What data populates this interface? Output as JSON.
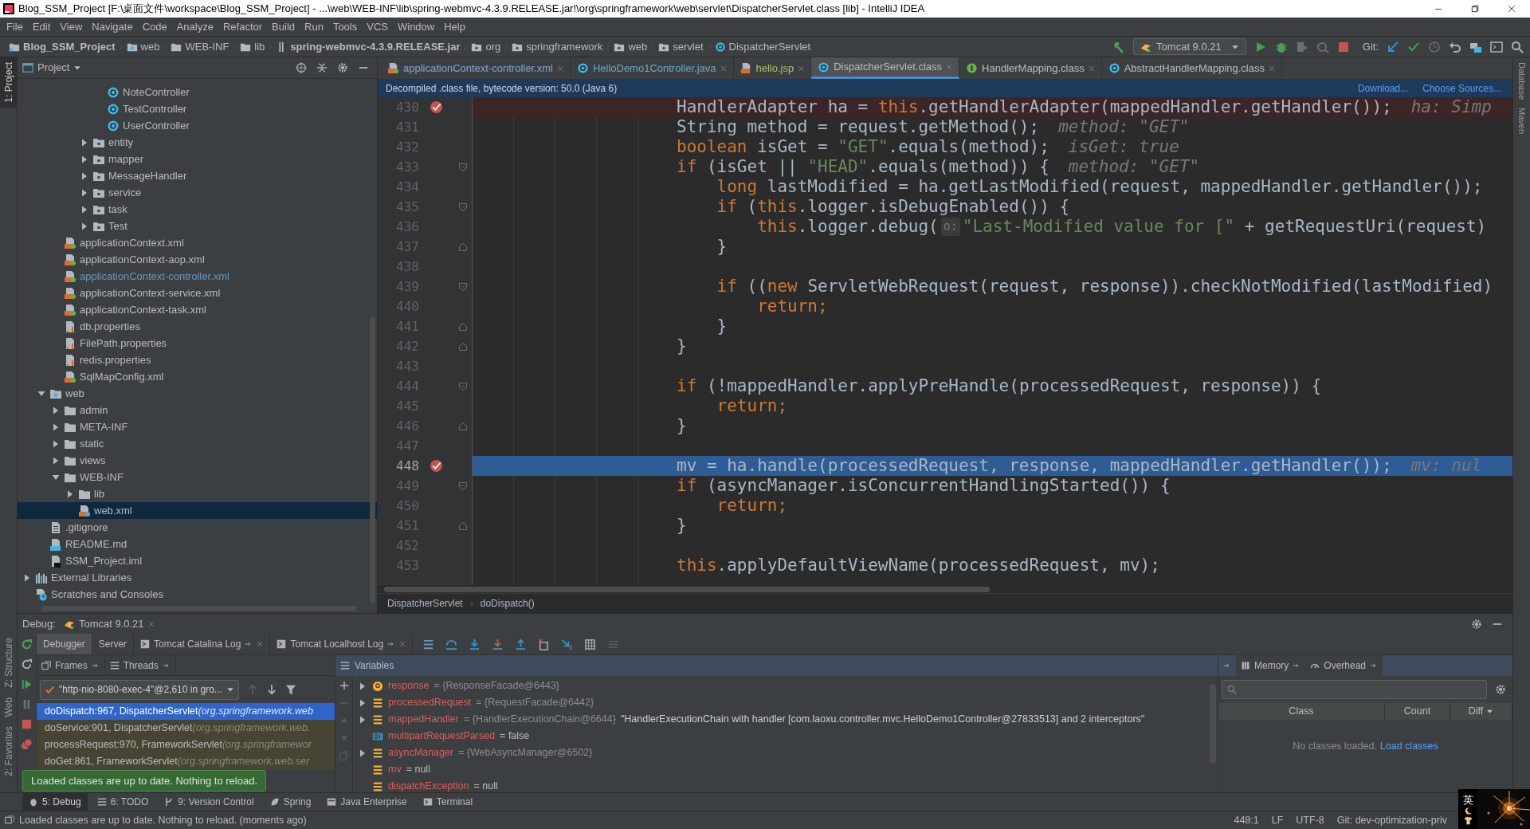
{
  "window": {
    "title": "Blog_SSM_Project [F:\\桌面文件\\workspace\\Blog_SSM_Project] - ...\\web\\WEB-INF\\lib\\spring-webmvc-4.3.9.RELEASE.jar!\\org\\springframework\\web\\servlet\\DispatcherServlet.class [lib] - IntelliJ IDEA"
  },
  "menu": [
    "File",
    "Edit",
    "View",
    "Navigate",
    "Code",
    "Analyze",
    "Refactor",
    "Build",
    "Run",
    "Tools",
    "VCS",
    "Window",
    "Help"
  ],
  "breadcrumbs": [
    {
      "label": "Blog_SSM_Project",
      "kind": "project"
    },
    {
      "label": "web",
      "kind": "webfolder"
    },
    {
      "label": "WEB-INF",
      "kind": "folder"
    },
    {
      "label": "lib",
      "kind": "folder"
    },
    {
      "label": "spring-webmvc-4.3.9.RELEASE.jar",
      "kind": "jar"
    },
    {
      "label": "org",
      "kind": "package"
    },
    {
      "label": "springframework",
      "kind": "package"
    },
    {
      "label": "web",
      "kind": "package"
    },
    {
      "label": "servlet",
      "kind": "package"
    },
    {
      "label": "DispatcherServlet",
      "kind": "class"
    }
  ],
  "run_config": "Tomcat 9.0.21",
  "vcs_label": "Git:",
  "left_tool_windows": [
    {
      "label": "1: Project",
      "selected": true
    },
    {
      "label": "Z: Structure",
      "selected": false
    },
    {
      "label": "Web",
      "selected": false
    },
    {
      "label": "2: Favorites",
      "selected": false
    }
  ],
  "right_tool_windows": [
    "Database",
    "Maven"
  ],
  "project": {
    "title": "Project",
    "tree": [
      {
        "children": [
          {
            "children": [
              {
                "children": [
                  {
                    "children": [
                      {
                        "children": [
                          {
                            "label": "NoteController",
                            "kind": "class"
                          },
                          {
                            "label": "TestController",
                            "kind": "class"
                          },
                          {
                            "label": "UserController",
                            "kind": "class"
                          }
                        ]
                      },
                      {
                        "label": "entity",
                        "kind": "package",
                        "expanded": false
                      },
                      {
                        "label": "mapper",
                        "kind": "package",
                        "expanded": false
                      },
                      {
                        "label": "MessageHandler",
                        "kind": "package",
                        "expanded": false
                      },
                      {
                        "label": "service",
                        "kind": "package",
                        "expanded": false
                      },
                      {
                        "label": "task",
                        "kind": "package",
                        "expanded": false
                      },
                      {
                        "label": "Test",
                        "kind": "package",
                        "expanded": false
                      }
                    ]
                  }
                ]
              },
              {
                "label": "applicationContext.xml",
                "kind": "xml",
                "modified": false
              },
              {
                "label": "applicationContext-aop.xml",
                "kind": "xml",
                "modified": false
              },
              {
                "label": "applicationContext-controller.xml",
                "kind": "xml",
                "modified": true
              },
              {
                "label": "applicationContext-service.xml",
                "kind": "xml",
                "modified": false
              },
              {
                "label": "applicationContext-task.xml",
                "kind": "xml",
                "modified": false
              },
              {
                "label": "db.properties",
                "kind": "properties"
              },
              {
                "label": "FilePath.properties",
                "kind": "properties"
              },
              {
                "label": "redis.properties",
                "kind": "properties"
              },
              {
                "label": "SqlMapConfig.xml",
                "kind": "xml",
                "modified": false
              }
            ]
          },
          {
            "label": "web",
            "kind": "webfolder",
            "expanded": true,
            "children": [
              {
                "label": "admin",
                "kind": "folder",
                "expanded": false
              },
              {
                "label": "META-INF",
                "kind": "folder",
                "expanded": false
              },
              {
                "label": "static",
                "kind": "folder",
                "expanded": false
              },
              {
                "label": "views",
                "kind": "folder",
                "expanded": false
              },
              {
                "label": "WEB-INF",
                "kind": "folder",
                "expanded": true,
                "children": [
                  {
                    "label": "lib",
                    "kind": "folder",
                    "expanded": false
                  },
                  {
                    "label": "web.xml",
                    "kind": "webxml",
                    "selected": true
                  }
                ]
              }
            ]
          },
          {
            "label": ".gitignore",
            "kind": "text"
          },
          {
            "label": "README.md",
            "kind": "markdown"
          },
          {
            "label": "SSM_Project.iml",
            "kind": "iml"
          }
        ]
      },
      {
        "label": "External Libraries",
        "kind": "libraries",
        "expanded": false
      },
      {
        "label": "Scratches and Consoles",
        "kind": "scratches"
      }
    ]
  },
  "editor_tabs": [
    {
      "label": "applicationContext-controller.xml",
      "kind": "xml",
      "selected": false,
      "color": "#7ea6d6"
    },
    {
      "label": "HelloDemo1Controller.java",
      "kind": "class",
      "selected": false,
      "color": "#6aa8c8"
    },
    {
      "label": "hello.jsp",
      "kind": "jsp",
      "selected": false,
      "color": "#a8c66c"
    },
    {
      "label": "DispatcherServlet.class",
      "kind": "class",
      "selected": true,
      "color": "#bbbbbb"
    },
    {
      "label": "HandlerMapping.class",
      "kind": "interface",
      "selected": false,
      "color": "#bbbbbb"
    },
    {
      "label": "AbstractHandlerMapping.class",
      "kind": "class",
      "selected": false,
      "color": "#bbbbbb"
    }
  ],
  "notice": {
    "text": "Decompiled .class file, bytecode version: 50.0 (Java 6)",
    "links": [
      "Download...",
      "Choose Sources..."
    ]
  },
  "code": [
    {
      "number": "430",
      "breakpoint": true,
      "current": false,
      "tokens": [
        {
          "kind": "plain",
          "text": "HandlerAdapter ha = "
        },
        {
          "kind": "keyword",
          "text": "this"
        },
        {
          "kind": "plain",
          "text": ".getHandlerAdapter(mappedHandler.getHandler());"
        },
        {
          "kind": "hint",
          "text": "ha: Simp"
        }
      ]
    },
    {
      "number": "431",
      "breakpoint": false,
      "current": false,
      "tokens": [
        {
          "kind": "plain",
          "text": "String method = request.getMethod();"
        },
        {
          "kind": "hint",
          "text": "method: \"GET\""
        }
      ]
    },
    {
      "number": "432",
      "breakpoint": false,
      "current": false,
      "tokens": [
        {
          "kind": "keyword",
          "text": "boolean"
        },
        {
          "kind": "plain",
          "text": " isGet = "
        },
        {
          "kind": "string",
          "text": "\"GET\""
        },
        {
          "kind": "plain",
          "text": ".equals(method);"
        },
        {
          "kind": "hint",
          "text": "isGet: true"
        }
      ]
    },
    {
      "number": "433",
      "breakpoint": false,
      "current": false,
      "fold_start": true,
      "tokens": [
        {
          "kind": "keyword",
          "text": "if"
        },
        {
          "kind": "plain",
          "text": " (isGet || "
        },
        {
          "kind": "string",
          "text": "\"HEAD\""
        },
        {
          "kind": "plain",
          "text": ".equals(method)) {"
        },
        {
          "kind": "hint",
          "text": "method: \"GET\""
        }
      ]
    },
    {
      "number": "434",
      "breakpoint": false,
      "current": false,
      "tokens": [
        {
          "kind": "keyword",
          "text": "    long"
        },
        {
          "kind": "plain",
          "text": " lastModified = ha.getLastModified(request, mappedHandler.getHandler());"
        }
      ]
    },
    {
      "number": "435",
      "breakpoint": false,
      "current": false,
      "fold_start": true,
      "tokens": [
        {
          "kind": "keyword",
          "text": "    if"
        },
        {
          "kind": "plain",
          "text": " ("
        },
        {
          "kind": "keyword",
          "text": "this"
        },
        {
          "kind": "plain",
          "text": ".logger.isDebugEnabled()) {"
        }
      ]
    },
    {
      "number": "436",
      "breakpoint": false,
      "current": false,
      "tokens": [
        {
          "kind": "keyword",
          "text": "        this"
        },
        {
          "kind": "plain",
          "text": ".logger.debug("
        },
        {
          "kind": "param_hint",
          "text": "o:"
        },
        {
          "kind": "string",
          "text": "\"Last-Modified value for [\""
        },
        {
          "kind": "plain",
          "text": " + getRequestUri(request)"
        }
      ]
    },
    {
      "number": "437",
      "breakpoint": false,
      "current": false,
      "fold_end": true,
      "tokens": [
        {
          "kind": "plain",
          "text": "    }"
        }
      ]
    },
    {
      "number": "438",
      "breakpoint": false,
      "current": false
    },
    {
      "number": "439",
      "breakpoint": false,
      "current": false,
      "fold_start": true,
      "tokens": [
        {
          "kind": "keyword",
          "text": "    if"
        },
        {
          "kind": "plain",
          "text": " (("
        },
        {
          "kind": "keyword",
          "text": "new"
        },
        {
          "kind": "plain",
          "text": " ServletWebRequest(request, response)).checkNotModified(lastModified)"
        }
      ]
    },
    {
      "number": "440",
      "breakpoint": false,
      "current": false,
      "tokens": [
        {
          "kind": "keyword",
          "text": "        return;"
        }
      ]
    },
    {
      "number": "441",
      "breakpoint": false,
      "current": false,
      "fold_end": true,
      "tokens": [
        {
          "kind": "plain",
          "text": "    }"
        }
      ]
    },
    {
      "number": "442",
      "breakpoint": false,
      "current": false,
      "fold_end": true,
      "tokens": [
        {
          "kind": "plain",
          "text": "}"
        }
      ]
    },
    {
      "number": "443",
      "breakpoint": false,
      "current": false
    },
    {
      "number": "444",
      "breakpoint": false,
      "current": false,
      "fold_start": true,
      "tokens": [
        {
          "kind": "keyword",
          "text": "if"
        },
        {
          "kind": "plain",
          "text": " (!mappedHandler.applyPreHandle(processedRequest, response)) {"
        }
      ]
    },
    {
      "number": "445",
      "breakpoint": false,
      "current": false,
      "tokens": [
        {
          "kind": "keyword",
          "text": "    return;"
        }
      ]
    },
    {
      "number": "446",
      "breakpoint": false,
      "current": false,
      "fold_end": true,
      "tokens": [
        {
          "kind": "plain",
          "text": "}"
        }
      ]
    },
    {
      "number": "447",
      "breakpoint": false,
      "current": false
    },
    {
      "number": "448",
      "breakpoint": true,
      "current": true,
      "tokens": [
        {
          "kind": "plain",
          "text": "mv = ha.handle(processedRequest, response, mappedHandler.getHandler());"
        },
        {
          "kind": "hint",
          "text": "mv: nul"
        }
      ]
    },
    {
      "number": "449",
      "breakpoint": false,
      "current": false,
      "fold_start": true,
      "tokens": [
        {
          "kind": "keyword",
          "text": "if"
        },
        {
          "kind": "plain",
          "text": " (asyncManager.isConcurrentHandlingStarted()) {"
        }
      ]
    },
    {
      "number": "450",
      "breakpoint": false,
      "current": false,
      "tokens": [
        {
          "kind": "keyword",
          "text": "    return;"
        }
      ]
    },
    {
      "number": "451",
      "breakpoint": false,
      "current": false,
      "fold_end": true,
      "tokens": [
        {
          "kind": "plain",
          "text": "}"
        }
      ]
    },
    {
      "number": "452",
      "breakpoint": false,
      "current": false
    },
    {
      "number": "453",
      "breakpoint": false,
      "current": false,
      "tokens": [
        {
          "kind": "keyword",
          "text": "this"
        },
        {
          "kind": "plain",
          "text": ".applyDefaultViewName(processedRequest, mv);"
        }
      ]
    }
  ],
  "editor_breadcrumbs": [
    "DispatcherServlet",
    "doDispatch()"
  ],
  "debug": {
    "label": "Debug:",
    "session": "Tomcat 9.0.21",
    "tabs": [
      {
        "label": "Debugger",
        "selected": true,
        "kind": "plain"
      },
      {
        "label": "Server",
        "selected": false,
        "kind": "plain"
      },
      {
        "label": "Tomcat Catalina Log",
        "selected": false,
        "kind": "log"
      },
      {
        "label": "Tomcat Localhost Log",
        "selected": false,
        "kind": "log"
      }
    ],
    "frame_tabs": [
      {
        "label": "Frames"
      },
      {
        "label": "Threads"
      }
    ],
    "thread": "\"http-nio-8080-exec-4\"@2,610 in gro...",
    "frames": [
      {
        "method": "doDispatch:967, DispatcherServlet",
        "package": "(org.springframework.web",
        "selected": true
      },
      {
        "method": "doService:901, DispatcherServlet",
        "package": "(org.springframework.web.",
        "selected": false
      },
      {
        "method": "processRequest:970, FrameworkServlet",
        "package": "(org.springframewor",
        "selected": false
      },
      {
        "method": "doGet:861, FrameworkServlet",
        "package": "(org.springframework.web.ser",
        "selected": false
      }
    ],
    "variables_title": "Variables",
    "variables": [
      {
        "name": "response",
        "value": "= {ResponseFacade@6443}",
        "kind": "param",
        "expandable": true
      },
      {
        "name": "processedRequest",
        "value": "= {RequestFacade@6442}",
        "kind": "field",
        "expandable": true
      },
      {
        "name": "mappedHandler",
        "value": "= {HandlerExecutionChain@6644}",
        "detail": "\"HandlerExecutionChain with handler [com.laoxu.controller.mvc.HelloDemo1Controller@27833513] and 2 interceptors\"",
        "kind": "field",
        "expandable": true
      },
      {
        "name": "multipartRequestParsed",
        "value": "= false",
        "kind": "primitive",
        "expandable": false
      },
      {
        "name": "asyncManager",
        "value": "= {WebAsyncManager@6502}",
        "kind": "field",
        "expandable": true
      },
      {
        "name": "mv",
        "value": "= null",
        "kind": "field",
        "expandable": false
      },
      {
        "name": "dispatchException",
        "value": "= null",
        "kind": "field",
        "expandable": false
      }
    ],
    "memory_tabs": [
      {
        "label": "Memory",
        "selected": false
      },
      {
        "label": "Overhead",
        "selected": false
      }
    ],
    "memory_columns": [
      "Class",
      "Count",
      "Diff"
    ],
    "memory_empty": "No classes loaded.",
    "memory_link": "Load classes"
  },
  "toast": "Loaded classes are up to date. Nothing to reload.",
  "bottom_tool_windows": [
    {
      "label": "5: Debug",
      "selected": true
    },
    {
      "label": "6: TODO",
      "selected": false
    },
    {
      "label": "9: Version Control",
      "selected": false
    },
    {
      "label": "Spring",
      "selected": false
    },
    {
      "label": "Java Enterprise",
      "selected": false
    },
    {
      "label": "Terminal",
      "selected": false
    }
  ],
  "status": {
    "message": "Loaded classes are up to date. Nothing to reload. (moments ago)",
    "position": "448:1",
    "line_separator": "LF",
    "encoding": "UTF-8",
    "vcs": "Git: dev-optimization-priv"
  },
  "ime": {
    "label": "英"
  }
}
